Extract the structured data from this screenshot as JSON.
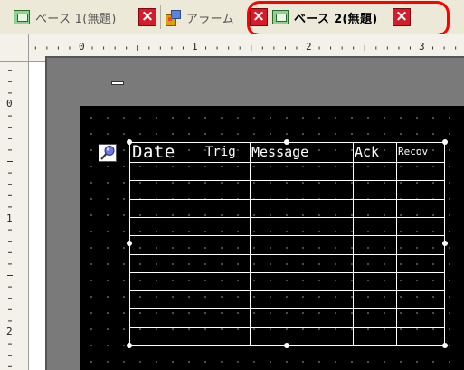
{
  "tabs": [
    {
      "label": "ベース 1(無題)",
      "icon": "base-screen-icon",
      "active": false
    },
    {
      "label": "アラーム",
      "icon": "alarm-icon",
      "active": false
    },
    {
      "label": "ベース 2(無題)",
      "icon": "base-screen-icon",
      "active": true
    }
  ],
  "close_glyph": "×",
  "ruler": {
    "horizontal": [
      "0",
      "1",
      "2",
      "3"
    ],
    "vertical": [
      "0",
      "1",
      "2"
    ]
  },
  "alarm_table": {
    "columns": [
      "Date",
      "Trig",
      "Message",
      "Ack",
      "Recov"
    ],
    "body_row_count": 10
  },
  "colors": {
    "highlight": "#ff0000",
    "close_button": "#d61c2a",
    "screen_background": "#000000",
    "table_lines": "#ffffff"
  }
}
